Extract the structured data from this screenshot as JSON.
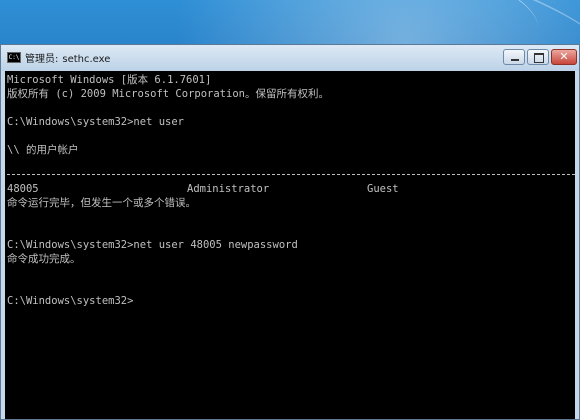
{
  "window": {
    "title_prefix": "管理员:",
    "title_name": "sethc.exe",
    "console_icon_label": "C:\\"
  },
  "console": {
    "lines": [
      "Microsoft Windows [版本 6.1.7601]",
      "版权所有 (c) 2009 Microsoft Corporation。保留所有权利。",
      "C:\\Windows\\system32>net user",
      "\\\\ 的用户帐户",
      "命令运行完毕，但发生一个或多个错误。",
      "C:\\Windows\\system32>net user 48005 newpassword",
      "命令成功完成。",
      "C:\\Windows\\system32>"
    ],
    "user_accounts": [
      "48005",
      "Administrator",
      "Guest"
    ]
  },
  "colors": {
    "console_bg": "#000000",
    "console_text": "#c0c0c0",
    "titlebar": "#cfe0f0"
  }
}
